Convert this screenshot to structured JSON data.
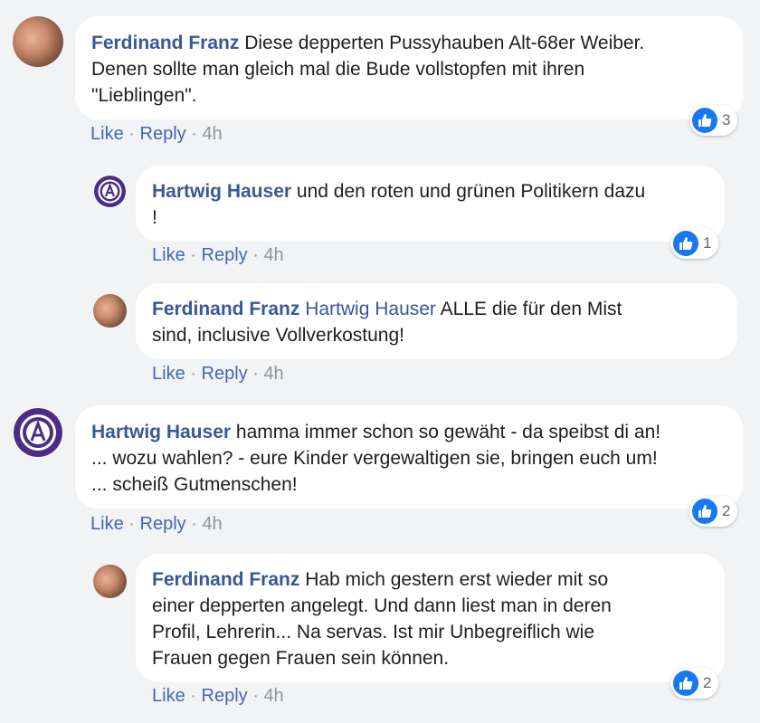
{
  "actions": {
    "like": "Like",
    "reply": "Reply",
    "dot": "·"
  },
  "colors": {
    "link": "#385898",
    "action": "#4267b2",
    "like_blue": "#1877f2",
    "background": "#f2f3f5"
  },
  "comments": [
    {
      "author": "Ferdinand Franz",
      "avatar": "photo",
      "lines": [
        "Diese depperten Pussyhauben Alt-68er Weiber.",
        "Denen sollte man gleich mal die Bude vollstopfen mit ihren",
        "\"Lieblingen\"."
      ],
      "time": "4h",
      "likes": "3"
    },
    {
      "author": "Hartwig Hauser",
      "avatar": "club-logo",
      "lines": [
        "und den roten und grünen Politikern dazu",
        "!"
      ],
      "time": "4h",
      "likes": "1"
    },
    {
      "author": "Ferdinand Franz",
      "avatar": "photo",
      "mention": "Hartwig Hauser",
      "lines": [
        "ALLE die für den Mist",
        "sind, inclusive Vollverkostung!"
      ],
      "time": "4h"
    },
    {
      "author": "Hartwig Hauser",
      "avatar": "club-logo",
      "lines": [
        "hamma immer schon so gewäht - da speibst di an!",
        "... wozu wahlen? - eure Kinder vergewaltigen sie, bringen euch um!",
        "... scheiß Gutmenschen!"
      ],
      "time": "4h",
      "likes": "2"
    },
    {
      "author": "Ferdinand Franz",
      "avatar": "photo",
      "lines": [
        "Hab mich gestern erst wieder mit so",
        "einer depperten angelegt. Und dann liest man in deren",
        "Profil, Lehrerin... Na servas. Ist mir Unbegreiflich wie",
        "Frauen gegen Frauen sein können."
      ],
      "time": "4h",
      "likes": "2"
    }
  ]
}
